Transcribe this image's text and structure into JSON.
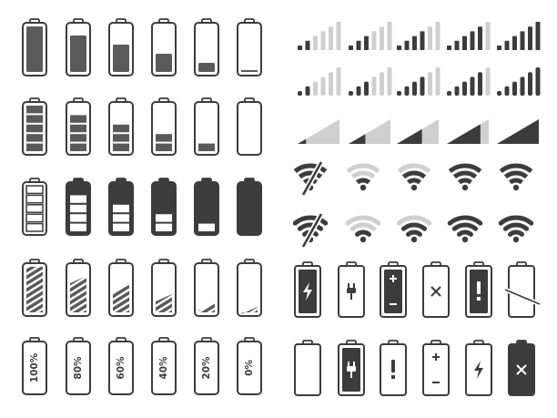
{
  "sheet": {
    "background": "#ffffff",
    "colors": {
      "dark": "#3c3c3c",
      "mid": "#5a5a5a",
      "light": "#cfcfcf"
    }
  },
  "battery_columns": [
    "full",
    "high",
    "mid-high",
    "mid",
    "low",
    "empty"
  ],
  "battery_fill_levels": [
    1.0,
    0.8,
    0.6,
    0.4,
    0.2,
    0.0
  ],
  "battery_rows": [
    {
      "name": "battery-solid-fill-row",
      "style": "solid-fill"
    },
    {
      "name": "battery-segmented-row",
      "style": "segmented"
    },
    {
      "name": "battery-inverted-segmented-row",
      "style": "inverted-segmented"
    },
    {
      "name": "battery-striped-row",
      "style": "striped"
    },
    {
      "name": "battery-percent-row",
      "style": "percent-label"
    }
  ],
  "percent_labels": [
    "100%",
    "80%",
    "60%",
    "40%",
    "20%",
    "0%"
  ],
  "signal_levels": [
    1,
    2,
    3,
    4,
    5
  ],
  "signal_rows": [
    {
      "name": "signal-bars-row-a",
      "style": "bars-flat-base"
    },
    {
      "name": "signal-bars-row-b",
      "style": "bars-rounded"
    },
    {
      "name": "signal-triangle-row",
      "style": "triangle"
    }
  ],
  "wifi_levels": [
    0,
    1,
    2,
    3,
    4
  ],
  "wifi_rows": [
    {
      "name": "wifi-row-a",
      "style": "arc-flat"
    },
    {
      "name": "wifi-row-b",
      "style": "arc-rounded"
    }
  ],
  "status_rows": [
    {
      "name": "battery-status-row-dark",
      "icons": [
        "charging-bolt-icon",
        "plug-icon",
        "plus-minus-icon",
        "cross-icon",
        "exclamation-icon",
        "broken-battery-icon"
      ]
    },
    {
      "name": "battery-status-row-light",
      "icons": [
        "empty-battery-icon",
        "plug-icon",
        "exclamation-icon",
        "plus-minus-icon",
        "charging-bolt-icon",
        "cross-icon"
      ]
    }
  ]
}
